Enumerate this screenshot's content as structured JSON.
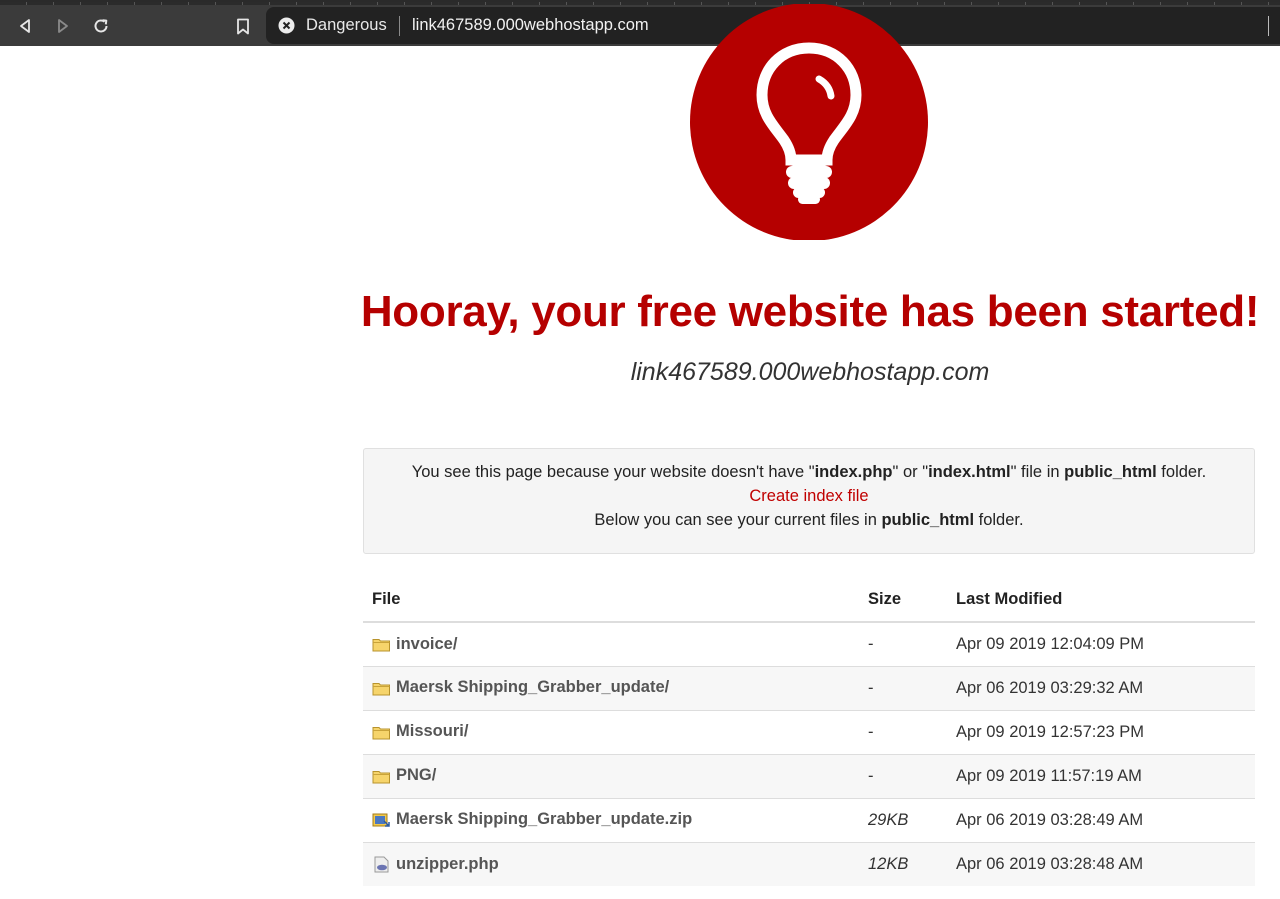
{
  "browser": {
    "security_label": "Dangerous",
    "url": "link467589.000webhostapp.com",
    "icons": [
      "back-icon",
      "forward-icon",
      "reload-icon",
      "bookmark-icon",
      "danger-icon"
    ]
  },
  "page": {
    "logo_icon": "lightbulb-icon",
    "headline": "Hooray, your free website has been started!",
    "subdomain": "link467589.000webhostapp.com",
    "notice": {
      "line1_a": "You see this page because your website doesn't have \"",
      "line1_b": "index.php",
      "line1_c": "\" or \"",
      "line1_d": "index.html",
      "line1_e": "\" file in ",
      "line1_f": "public_html",
      "line1_g": " folder.",
      "create_link": "Create index file",
      "line3_a": "Below you can see your current files in ",
      "line3_b": "public_html",
      "line3_c": " folder."
    },
    "table": {
      "headers": {
        "file": "File",
        "size": "Size",
        "modified": "Last Modified"
      },
      "rows": [
        {
          "name": "invoice/",
          "icon": "folder-icon",
          "size": "-",
          "modified": "Apr 09 2019 12:04:09 PM"
        },
        {
          "name": "Maersk Shipping_Grabber_update/",
          "icon": "folder-icon",
          "size": "-",
          "modified": "Apr 06 2019 03:29:32 AM"
        },
        {
          "name": "Missouri/",
          "icon": "folder-icon",
          "size": "-",
          "modified": "Apr 09 2019 12:57:23 PM"
        },
        {
          "name": "PNG/",
          "icon": "folder-icon",
          "size": "-",
          "modified": "Apr 09 2019 11:57:19 AM"
        },
        {
          "name": "Maersk Shipping_Grabber_update.zip",
          "icon": "zip-file-icon",
          "size": "29KB",
          "modified": "Apr 06 2019 03:28:49 AM"
        },
        {
          "name": "unzipper.php",
          "icon": "php-file-icon",
          "size": "12KB",
          "modified": "Apr 06 2019 03:28:48 AM"
        }
      ]
    }
  },
  "colors": {
    "brand_red": "#b50000",
    "link_red": "#c00000",
    "toolbar": "#3b3b3b",
    "omnibox": "#222222"
  }
}
